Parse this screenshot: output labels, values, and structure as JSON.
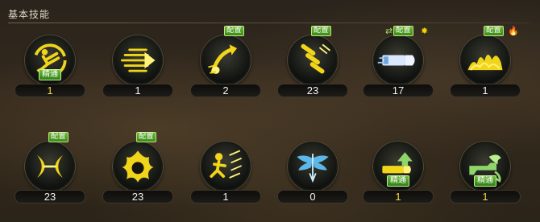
{
  "section": {
    "title": "基本技能"
  },
  "labels": {
    "config": "配置",
    "mastery": "精通"
  },
  "marks": {
    "spark": "✸",
    "fire": "🔥",
    "link": "⇄"
  },
  "colors": {
    "icon_gold": "#f1d51a",
    "icon_blue": "#5cb8e8",
    "icon_green": "#8ed66a",
    "badge_green": "#4f9d2a",
    "level_gold": "#f3d84a"
  },
  "skills": [
    {
      "icon": "kick-icon",
      "level": "1",
      "level_gold": true,
      "configured": false,
      "mastery": true
    },
    {
      "icon": "dash-strike-icon",
      "level": "1",
      "level_gold": false,
      "configured": false,
      "mastery": false
    },
    {
      "icon": "upward-slash-icon",
      "level": "2",
      "level_gold": false,
      "configured": true,
      "mastery": false
    },
    {
      "icon": "bullet-barrage-icon",
      "level": "23",
      "level_gold": false,
      "configured": true,
      "mastery": false
    },
    {
      "icon": "bullet-icon",
      "level": "17",
      "level_gold": false,
      "configured": true,
      "mastery": false,
      "link_mark": true,
      "spark_mark": true
    },
    {
      "icon": "flame-wave-icon",
      "level": "1",
      "level_gold": false,
      "configured": true,
      "mastery": false,
      "fire_mark": true
    },
    {
      "icon": "crescent-slash-icon",
      "level": "23",
      "level_gold": false,
      "configured": true,
      "mastery": false
    },
    {
      "icon": "fire-burst-icon",
      "level": "23",
      "level_gold": false,
      "configured": true,
      "mastery": false
    },
    {
      "icon": "leaping-strike-icon",
      "level": "1",
      "level_gold": false,
      "configured": false,
      "mastery": false
    },
    {
      "icon": "blue-wings-icon",
      "level": "0",
      "level_gold": false,
      "configured": false,
      "mastery": false
    },
    {
      "icon": "bullet-up-icon",
      "level": "1",
      "level_gold": true,
      "configured": false,
      "mastery": true
    },
    {
      "icon": "dragon-gun-icon",
      "level": "1",
      "level_gold": true,
      "configured": false,
      "mastery": true
    }
  ]
}
